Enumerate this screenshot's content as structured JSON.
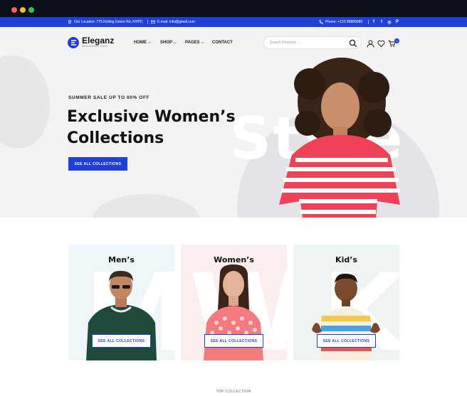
{
  "topbar": {
    "location": "Our Location: 775 Rolling Green Rd, NYPD",
    "email": "E-mail: info@gmail.com",
    "phone": "Phone: +123 99889989",
    "social_icons": [
      "facebook-icon",
      "twitter-icon",
      "instagram-icon",
      "pinterest-icon"
    ],
    "social_glyphs": [
      "f",
      "t",
      "◎",
      "P"
    ]
  },
  "header": {
    "logo_name": "Eleganz",
    "logo_tagline": "WooCommerce Theme",
    "nav": {
      "home": "HOME",
      "shop": "SHOP",
      "pages": "PAGES",
      "contact": "CONTACT"
    },
    "search_placeholder": "Search Products ...",
    "cart_count": "0"
  },
  "hero": {
    "eyebrow": "SUMMER SALE UP TO 60% OFF",
    "title": "Exclusive Women’s Collections",
    "button": "SEE ALL COLLECTIONS",
    "background_word": "Style"
  },
  "categories": [
    {
      "name": "Men’s",
      "letter": "M",
      "button": "SEE ALL COLLECTIONS",
      "bg": "#eef6fa"
    },
    {
      "name": "Women’s",
      "letter": "W",
      "button": "SEE ALL COLLECTIONS",
      "bg": "#fbeeee"
    },
    {
      "name": "Kid’s",
      "letter": "K",
      "button": "SEE ALL COLLECTIONS",
      "bg": "#eef4f2"
    }
  ],
  "section_label": "TOP COLLECTION",
  "colors": {
    "brand": "#1f3fd6",
    "hero_bg": "#f3f3f5"
  }
}
